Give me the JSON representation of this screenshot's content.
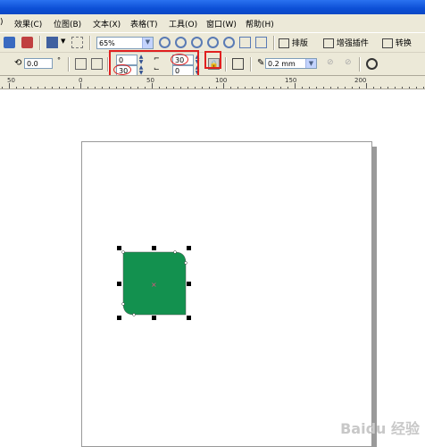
{
  "menu": {
    "items": [
      "效果(C)",
      "位图(B)",
      "文本(X)",
      "表格(T)",
      "工具(O)",
      "窗口(W)",
      "帮助(H)"
    ]
  },
  "toolbar1": {
    "zoom": "65%",
    "buttons": {
      "layout": "排版",
      "enhance_plugin": "增强插件",
      "convert": "转换"
    }
  },
  "toolbar2": {
    "rotation": "0.0",
    "corner_top_left": "0",
    "corner_bottom_left": "30",
    "corner_top_right": "30",
    "corner_bottom_right": "0",
    "outline_width": "0.2 mm"
  },
  "ruler": {
    "labels": [
      "50",
      "0",
      "50",
      "100",
      "150",
      "200"
    ]
  },
  "shape": {
    "fill": "#13914f"
  },
  "colors": {
    "highlight": "#e02020",
    "toolbar_bg": "#ece9d8"
  },
  "watermark": "Baidu 经验"
}
